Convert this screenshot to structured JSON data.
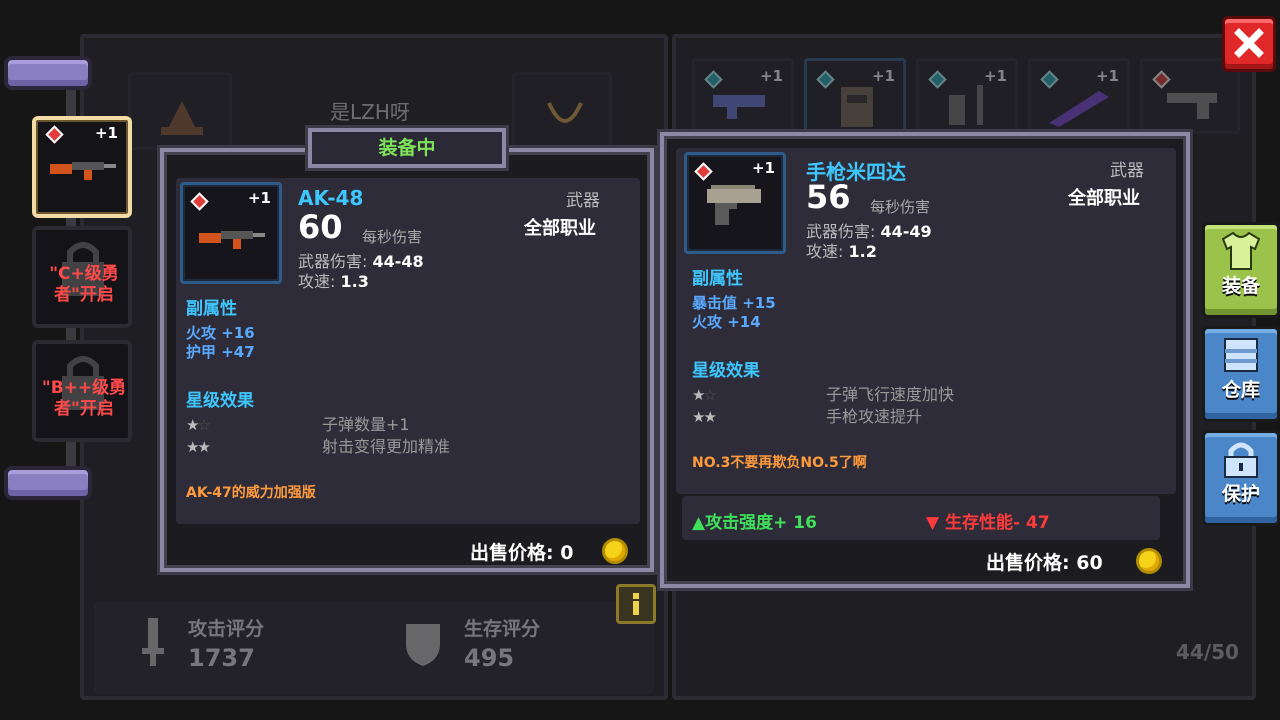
{
  "player_name": "是LZH呀",
  "left_locks": [
    "\"C+级勇者\"开启",
    "\"B++级勇者\"开启"
  ],
  "bottom_stats": {
    "attack_label": "攻击评分",
    "attack_value": "1737",
    "survival_label": "生存评分",
    "survival_value": "495"
  },
  "inventory_count": "44/50",
  "inventory_plus": [
    "+1",
    "+1",
    "+1",
    "+1"
  ],
  "equipped_header": "装备中",
  "equipped": {
    "plus": "+1",
    "name": "AK-48",
    "dps": "60",
    "dps_label": "每秒伤害",
    "damage_label": "武器伤害:",
    "damage_value": "44-48",
    "speed_label": "攻速:",
    "speed_value": "1.3",
    "type": "武器",
    "class": "全部职业",
    "sub_title": "副属性",
    "sub_stats": [
      "火攻 +16",
      "护甲 +47"
    ],
    "star_title": "星级效果",
    "star_effects": [
      "子弹数量+1",
      "射击变得更加精准"
    ],
    "description": "AK-47的威力加强版",
    "sell_label": "出售价格:",
    "sell_value": "0"
  },
  "compare": {
    "plus": "+1",
    "name": "手枪米四达",
    "dps": "56",
    "dps_label": "每秒伤害",
    "damage_label": "武器伤害:",
    "damage_value": "44-49",
    "speed_label": "攻速:",
    "speed_value": "1.2",
    "type": "武器",
    "class": "全部职业",
    "sub_title": "副属性",
    "sub_stats": [
      "暴击值 +15",
      "火攻 +14"
    ],
    "star_title": "星级效果",
    "star_effects": [
      "子弹飞行速度加快",
      "手枪攻速提升"
    ],
    "description": "NO.3不要再欺负NO.5了啊",
    "attack_change": "▲攻击强度+ 16",
    "survival_change": "▼ 生存性能- 47",
    "sell_label": "出售价格:",
    "sell_value": "60"
  },
  "tabs": [
    "装备",
    "仓库",
    "保护"
  ],
  "colors": {
    "accent_blue": "#3ec7ff",
    "orange": "#ff9b3d",
    "up_green": "#3fe05a",
    "down_red": "#ff3b3b",
    "close_red": "#e02828"
  }
}
